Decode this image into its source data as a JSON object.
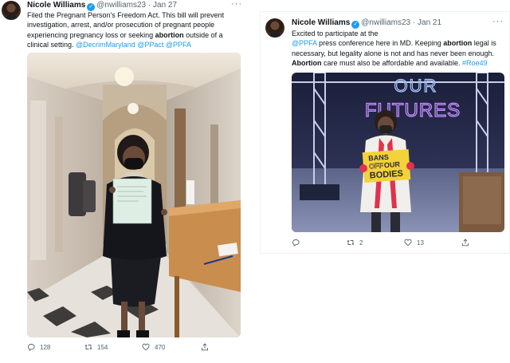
{
  "tweet1": {
    "name": "Nicole Williams",
    "handle": "@nwilliams23",
    "dot": "·",
    "date": "Jan 27",
    "more": "···",
    "text_parts": [
      "Filed the Pregnant Person's Freedom Act. This bill will prevent investigation, arrest, and/or prosecution of pregnant people experiencing pregnancy loss or seeking ",
      "abortion",
      " outside of a clinical setting. ",
      "@DecrimMaryland",
      " ",
      "@PPact",
      " ",
      "@PPFA"
    ],
    "actions": {
      "reply_count": "128",
      "retweet_count": "154",
      "like_count": "470"
    }
  },
  "tweet2": {
    "name": "Nicole Williams",
    "handle": "@nwilliams23",
    "dot": "·",
    "date": "Jan 21",
    "more": "···",
    "text_parts": [
      "Excited to participate at the ",
      "@PPFA",
      " press conference here in MD. Keeping ",
      "abortion",
      " legal is necessary, but legality alone is not and has never been enough. ",
      "Abortion",
      " care must also be affordable and available. ",
      "#Roe49"
    ],
    "sign": {
      "line1": "OUR",
      "line2": "FUTURES",
      "placard1": "BANS",
      "placard2": "OFF",
      "placard3": "OUR",
      "placard4": "BODIES"
    },
    "actions": {
      "retweet_count": "2",
      "like_count": "13"
    }
  },
  "colors": {
    "accent": "#1d9bf0",
    "muted": "#536471",
    "text": "#0f1419"
  }
}
